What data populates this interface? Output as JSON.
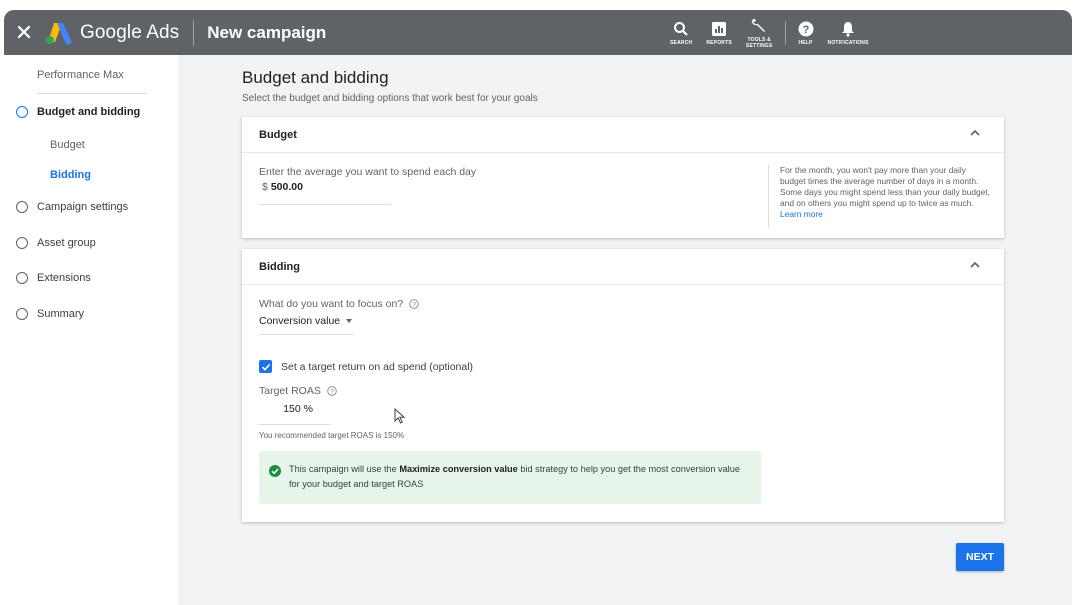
{
  "topbar": {
    "brand": "Google Ads",
    "title": "New campaign",
    "tools": [
      {
        "icon": "search-icon",
        "label": "SEARCH"
      },
      {
        "icon": "reports-icon",
        "label": "REPORTS"
      },
      {
        "icon": "wrench-icon",
        "label": "TOOLS &\nSETTINGS"
      },
      {
        "icon": "help-icon",
        "label": "HELP"
      },
      {
        "icon": "bell-icon",
        "label": "NOTIFICATIONS"
      }
    ]
  },
  "sidebar": {
    "performance_max": "Performance Max",
    "items": [
      {
        "label": "Budget and bidding",
        "active": true
      },
      {
        "label": "Campaign settings",
        "active": false
      },
      {
        "label": "Asset group",
        "active": false
      },
      {
        "label": "Extensions",
        "active": false
      },
      {
        "label": "Summary",
        "active": false
      }
    ],
    "subitems": [
      {
        "label": "Budget",
        "active": false
      },
      {
        "label": "Bidding",
        "active": true
      }
    ]
  },
  "main": {
    "title": "Budget and bidding",
    "subtitle": "Select the budget and bidding options that work best for your goals"
  },
  "budget": {
    "header": "Budget",
    "label": "Enter the average you want to spend each day",
    "currency": "$",
    "amount": "500.00",
    "note": "For the month, you won't pay more than your daily budget times the average number of days in a month. Some days you might spend less than your daily budget, and on others you might spend up to twice as much.",
    "learn_more": "Learn more"
  },
  "bidding": {
    "header": "Bidding",
    "focus_question": "What do you want to focus on?",
    "focus_value": "Conversion value",
    "target_checkbox_label": "Set a target return on ad spend (optional)",
    "target_checked": true,
    "roas_label": "Target ROAS",
    "roas_value": "150 %",
    "roas_hint": "You recommended target ROAS is 150%",
    "info_prefix": "This campaign will use the ",
    "info_strategy": "Maximize conversion value",
    "info_suffix": " bid strategy to help you get the most conversion value for your budget and target ROAS"
  },
  "actions": {
    "next": "NEXT"
  },
  "colors": {
    "topbar": "#5f6368",
    "accent": "#1a73e8",
    "success_bg": "#e6f4ea",
    "success_icon": "#1e8e3e"
  }
}
